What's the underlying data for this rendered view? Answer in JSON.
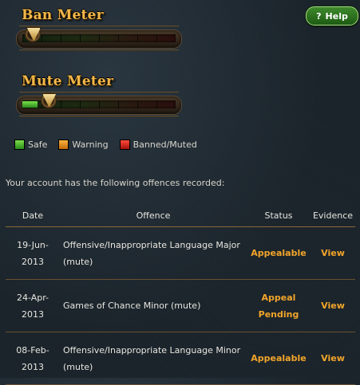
{
  "ban_meter": {
    "title": "Ban Meter",
    "level": 0.07,
    "fill": 0.0
  },
  "mute_meter": {
    "title": "Mute Meter",
    "level": 0.17,
    "fill": 0.1
  },
  "help_button": {
    "label": "Help",
    "icon": "question-mark-icon"
  },
  "legend": [
    {
      "label": "Safe",
      "color": "#3aa622"
    },
    {
      "label": "Warning",
      "color": "#e88a15"
    },
    {
      "label": "Banned/Muted",
      "color": "#d11e12"
    }
  ],
  "intro_text": "Your account has the following offences recorded:",
  "table": {
    "headers": {
      "date": "Date",
      "offence": "Offence",
      "status": "Status",
      "evidence": "Evidence"
    },
    "rows": [
      {
        "date_line1": "19-Jun-",
        "date_line2": "2013",
        "offence_line1": "Offensive/Inappropriate Language Major",
        "offence_line2": "(mute)",
        "status_line1": "Appealable",
        "status_line2": "",
        "evidence": "View"
      },
      {
        "date_line1": "24-Apr-",
        "date_line2": "2013",
        "offence_line1": "Games of Chance Minor (mute)",
        "offence_line2": "",
        "status_line1": "Appeal",
        "status_line2": "Pending",
        "evidence": "View"
      },
      {
        "date_line1": "08-Feb-",
        "date_line2": "2013",
        "offence_line1": "Offensive/Inappropriate Language Minor",
        "offence_line2": "(mute)",
        "status_line1": "Appealable",
        "status_line2": "",
        "evidence": "View"
      }
    ]
  }
}
